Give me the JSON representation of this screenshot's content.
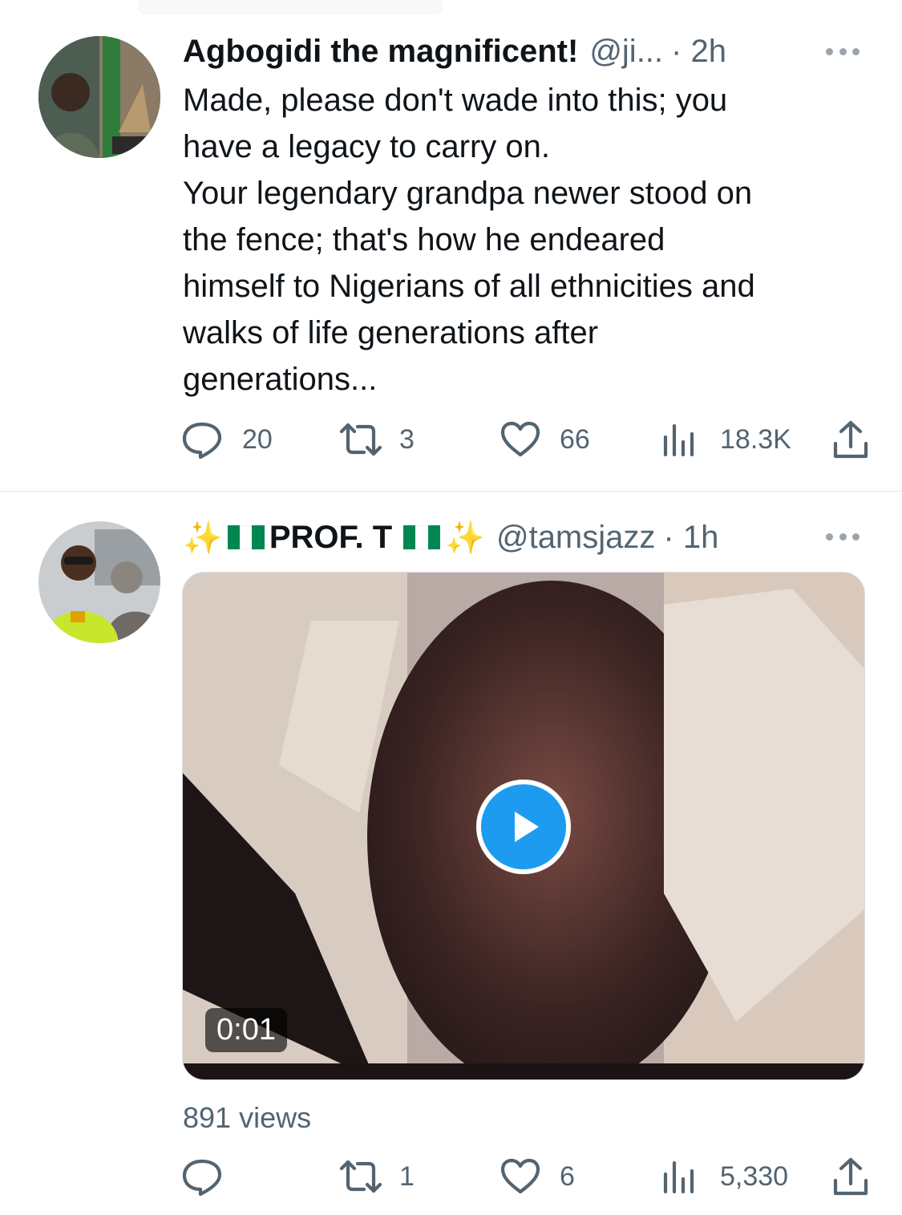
{
  "tweets": [
    {
      "display_name": "Agbogidi the magnificent!",
      "handle": "@ji...",
      "time": "· 2h",
      "text_lines": [
        "Made, please don't wade into this; you",
        "have a legacy to carry on.",
        "Your legendary grandpa newer stood on",
        "the fence; that's how he endeared",
        "himself to Nigerians of all ethnicities and",
        "walks of life generations after",
        "generations..."
      ],
      "replies": "20",
      "retweets": "3",
      "likes": "66",
      "views": "18.3K"
    },
    {
      "display_name_sparkle": "✨",
      "display_name": "PROF. T",
      "handle": "@tamsjazz",
      "time": "· 1h",
      "video_duration": "0:01",
      "video_views": "891 views",
      "replies": "",
      "retweets": "1",
      "likes": "6",
      "views": "5,330"
    }
  ],
  "icons": {
    "reply": "reply-icon",
    "retweet": "retweet-icon",
    "like": "heart-icon",
    "views": "bar-chart-icon",
    "share": "share-icon",
    "more": "more-icon",
    "play": "play-icon",
    "flag": "nigeria-flag-icon"
  },
  "colors": {
    "text_primary": "#0f1419",
    "text_secondary": "#536471",
    "play_button": "#1d9bf0",
    "flag_green": "#008751"
  }
}
